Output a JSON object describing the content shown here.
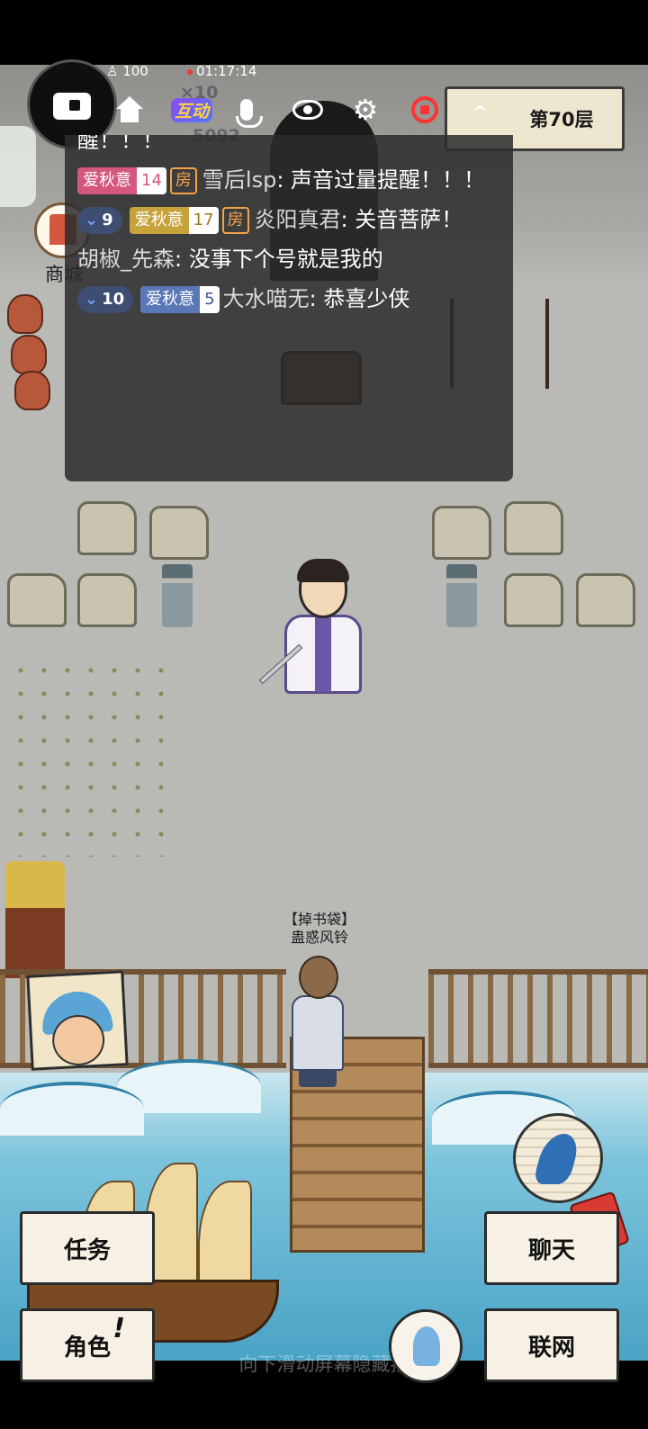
{
  "live": {
    "viewers": "100",
    "timer": "01:17:14",
    "ghost_multiplier": "×10",
    "ghost_count": "5092",
    "interact_label": "互动"
  },
  "floor_button": {
    "caret": "^",
    "label": "第70层"
  },
  "shop": {
    "label": "商城"
  },
  "player": {
    "tag": "【掉书袋】",
    "name": "蛊惑风铃"
  },
  "chat": {
    "messages": [
      {
        "text": "醒！！！"
      },
      {
        "fan_name": "爱秋意",
        "fan_level": "14",
        "room": "房",
        "user": "雪后lsp",
        "text": "声音过量提醒！！！"
      },
      {
        "level": "9",
        "fan_name": "爱秋意",
        "fan_level": "17",
        "room": "房",
        "user": "炎阳真君",
        "text": "关音菩萨！"
      },
      {
        "user": "胡椒_先森",
        "text": "没事下个号就是我的"
      },
      {
        "level": "10",
        "fan_name": "爱秋意",
        "fan_level": "5",
        "user": "大水喵无",
        "text": "恭喜少侠"
      }
    ]
  },
  "actions": {
    "task": "任务",
    "chat": "聊天",
    "role": "角色",
    "role_mark": "!",
    "network": "联网"
  },
  "hint": "向下滑动屏幕隐藏按",
  "colors": {
    "chat_bg": "#2c2c2c",
    "button_bg": "#f6f1e4",
    "fan_pink": "#d4577d",
    "fan_gold": "#c7a23a",
    "room_orange": "#f2a34a",
    "record_red": "#ff3333"
  },
  "icons": [
    "home-icon",
    "interact-icon",
    "mic-icon",
    "eye-icon",
    "gear-icon",
    "record-icon",
    "run-icon",
    "red-packet-icon",
    "meditate-icon"
  ]
}
